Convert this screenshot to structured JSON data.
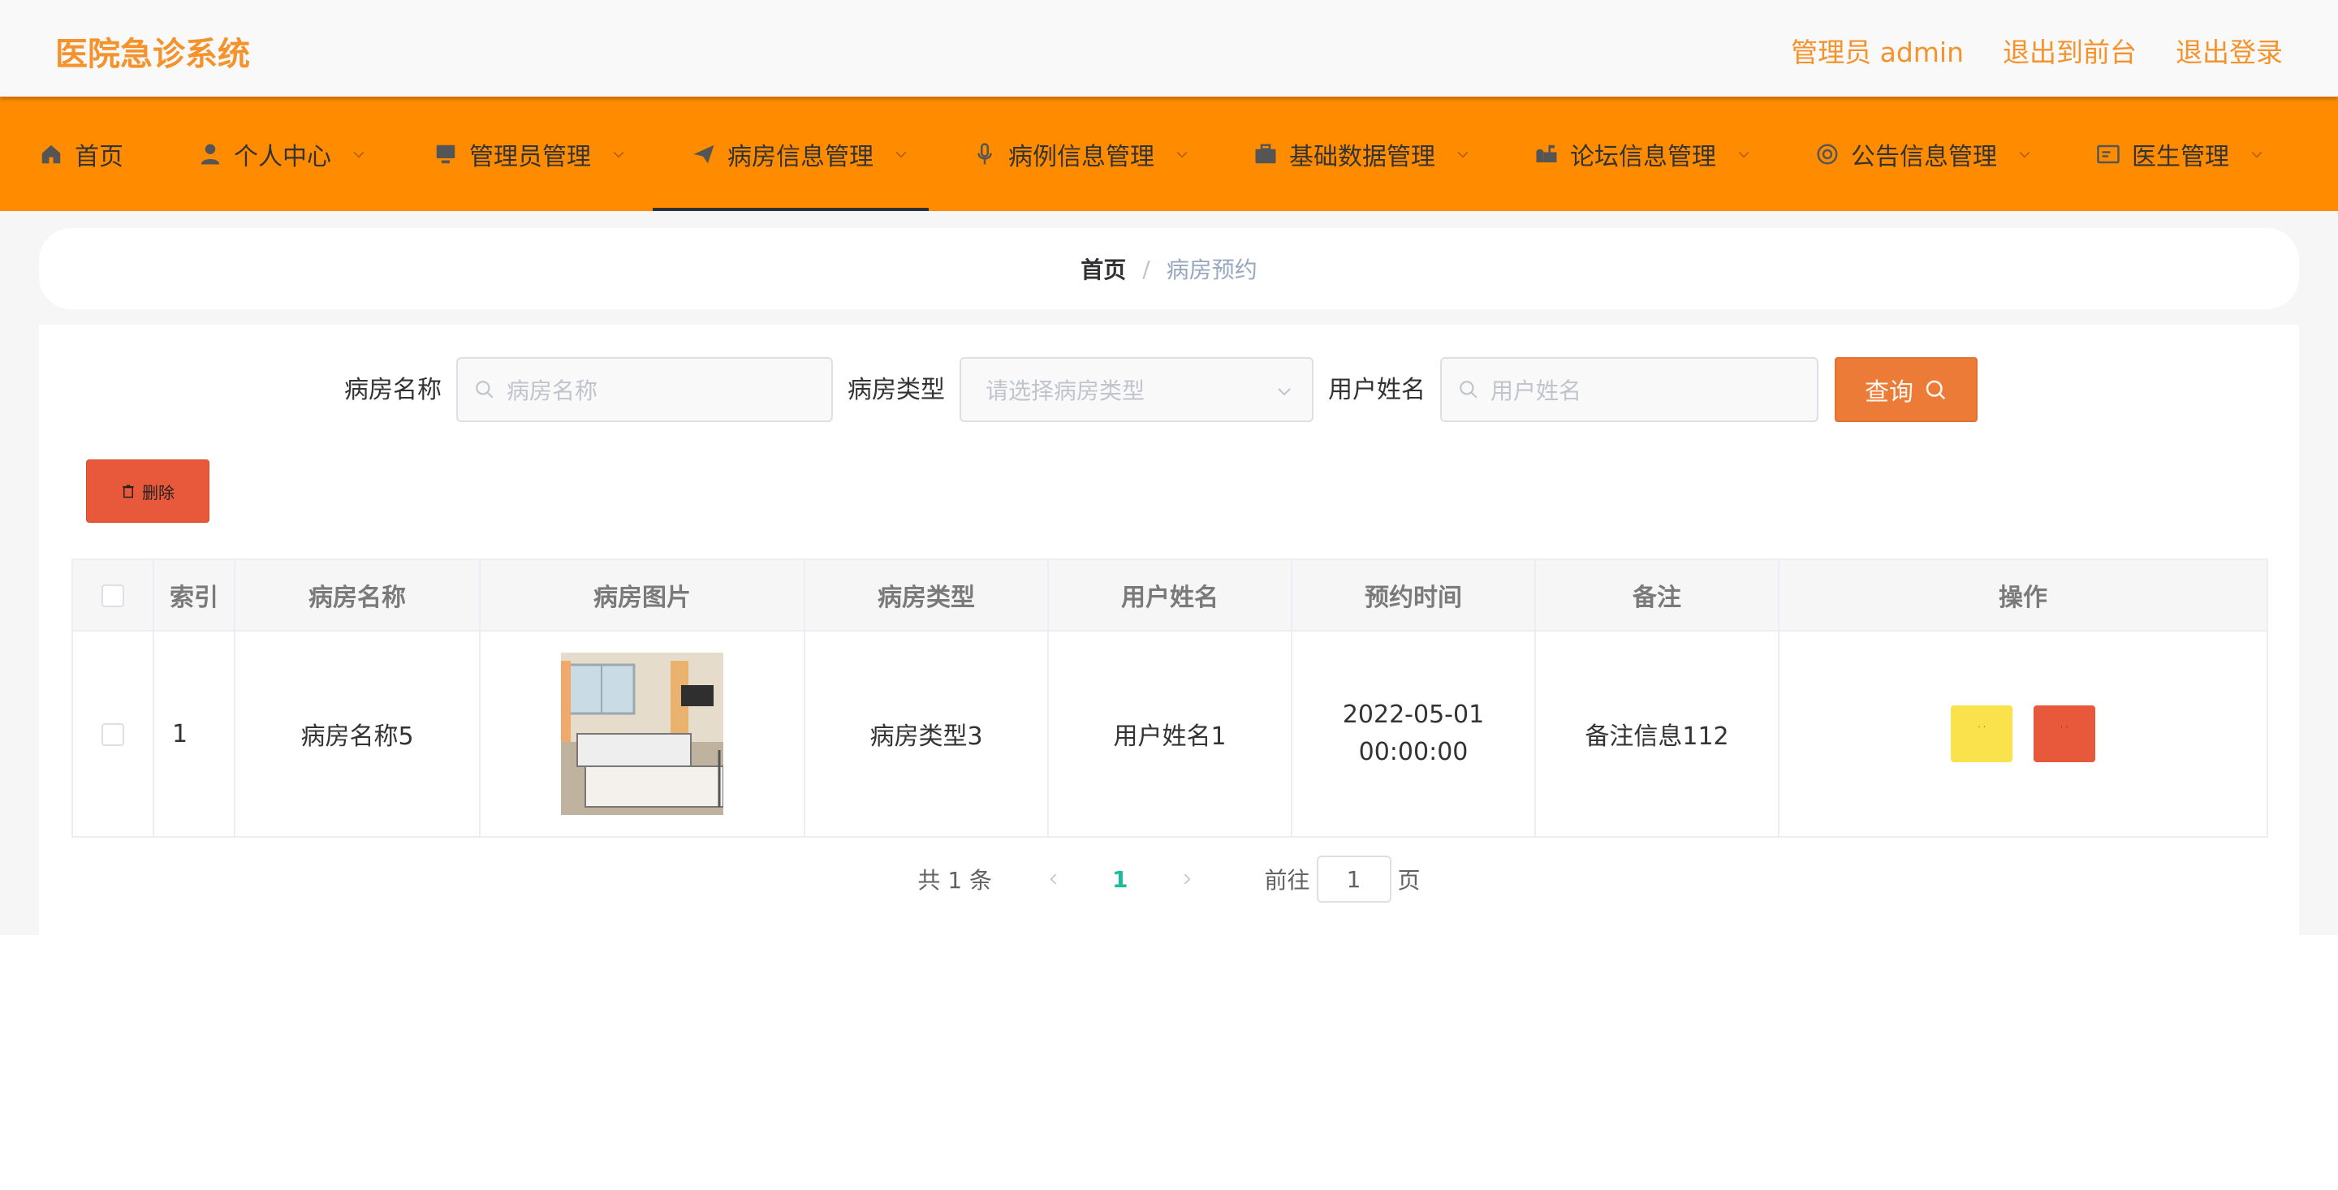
{
  "header": {
    "brand": "医院急诊系统",
    "links": [
      "管理员 admin",
      "退出到前台",
      "退出登录"
    ],
    "brand_color": "#f5922b"
  },
  "nav": {
    "bar_color": "#ff8c00",
    "items": [
      {
        "label": "首页",
        "icon": "home-icon"
      },
      {
        "label": "个人中心",
        "icon": "user-icon"
      },
      {
        "label": "管理员管理",
        "icon": "monitor-icon"
      },
      {
        "label": "病房信息管理",
        "icon": "paper-plane-icon"
      },
      {
        "label": "病例信息管理",
        "icon": "microphone-icon"
      },
      {
        "label": "基础数据管理",
        "icon": "briefcase-icon"
      },
      {
        "label": "论坛信息管理",
        "icon": "mailbox-icon"
      },
      {
        "label": "公告信息管理",
        "icon": "target-icon"
      },
      {
        "label": "医生管理",
        "icon": "id-card-icon"
      }
    ],
    "active": "病房信息管理"
  },
  "breadcrumb": {
    "home": "首页",
    "separator": "/",
    "current": "病房预约"
  },
  "search": {
    "fields": [
      {
        "label": "病房名称",
        "placeholder": "病房名称"
      },
      {
        "label": "病房类型",
        "placeholder": "请选择病房类型"
      },
      {
        "label": "用户姓名",
        "placeholder": "用户姓名"
      }
    ],
    "button": "查询",
    "button_color": "#ed7b38"
  },
  "actions": {
    "delete": "删除",
    "delete_color": "#e8583a"
  },
  "table": {
    "columns": [
      "索引",
      "病房名称",
      "病房图片",
      "病房类型",
      "用户姓名",
      "预约时间",
      "备注",
      "操作"
    ],
    "rows": [
      {
        "index": "1",
        "name": "病房名称5",
        "type": "病房类型3",
        "user": "用户姓名1",
        "time": "2022-05-01 00:00:00",
        "note": "备注信息112",
        "edit_label": "· ·",
        "delete_label": "· ·"
      }
    ]
  },
  "pagination": {
    "total": "共 1 条",
    "current_page": "1",
    "goto_label": "前往",
    "goto_value": "1",
    "page_suffix": "页",
    "active_color": "#1abc9c"
  }
}
